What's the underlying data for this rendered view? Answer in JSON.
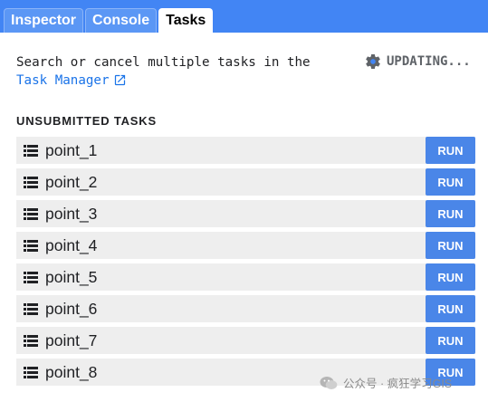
{
  "tabs": [
    {
      "label": "Inspector",
      "active": false
    },
    {
      "label": "Console",
      "active": false
    },
    {
      "label": "Tasks",
      "active": true
    }
  ],
  "intro": {
    "text": "Search or cancel multiple tasks in the",
    "link_label": "Task Manager"
  },
  "status": {
    "label": "UPDATING...",
    "icon": "gear-icon"
  },
  "section_title": "UNSUBMITTED TASKS",
  "tasks": [
    {
      "name": "point_1",
      "button": "RUN"
    },
    {
      "name": "point_2",
      "button": "RUN"
    },
    {
      "name": "point_3",
      "button": "RUN"
    },
    {
      "name": "point_4",
      "button": "RUN"
    },
    {
      "name": "point_5",
      "button": "RUN"
    },
    {
      "name": "point_6",
      "button": "RUN"
    },
    {
      "name": "point_7",
      "button": "RUN"
    },
    {
      "name": "point_8",
      "button": "RUN"
    }
  ],
  "watermark": {
    "text": "公众号 · 疯狂学习GIS"
  },
  "colors": {
    "accent": "#4285f4",
    "run_button": "#4a86e8",
    "row_bg": "#eeeeee",
    "link": "#1a73e8"
  }
}
